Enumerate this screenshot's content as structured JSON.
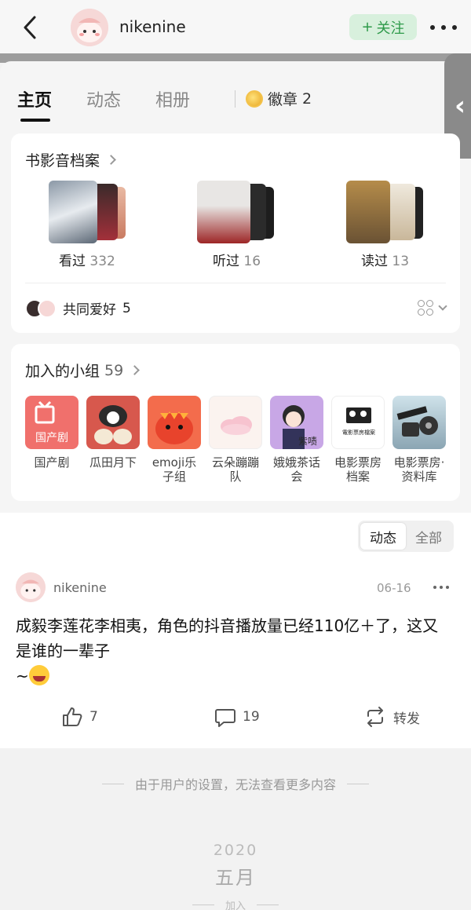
{
  "header": {
    "username": "nikenine",
    "follow_label": "关注",
    "follow_plus": "+"
  },
  "tabs": [
    {
      "label": "主页",
      "active": true
    },
    {
      "label": "动态",
      "active": false
    },
    {
      "label": "相册",
      "active": false
    }
  ],
  "badge": {
    "label": "徽章",
    "count": "2"
  },
  "archive": {
    "title": "书影音档案",
    "items": [
      {
        "label": "看过",
        "count": "332"
      },
      {
        "label": "听过",
        "count": "16"
      },
      {
        "label": "读过",
        "count": "13"
      }
    ],
    "common_label": "共同爱好",
    "common_count": "5"
  },
  "groups": {
    "title": "加入的小组",
    "count": "59",
    "items": [
      {
        "name": "国产剧",
        "img_text": "国产剧"
      },
      {
        "name": "瓜田月下"
      },
      {
        "name": "emoji乐子组"
      },
      {
        "name": "云朵蹦蹦队"
      },
      {
        "name": "娥娥茶话会",
        "img_text": "紫啧"
      },
      {
        "name": "电影票房档案",
        "img_text": "電影票房檔案"
      },
      {
        "name": "电影票房·资料库"
      }
    ]
  },
  "feed_filter": {
    "options": [
      "动态",
      "全部"
    ],
    "selected": "动态"
  },
  "post": {
    "username": "nikenine",
    "date": "06-16",
    "text": "成毅李莲花李相夷，角色的抖音播放量已经110亿＋了，这又是谁的一辈子",
    "text_tail": "~",
    "likes": "7",
    "comments": "19",
    "repost_label": "转发"
  },
  "footer": {
    "note": "由于用户的设置，无法查看更多内容",
    "year": "2020",
    "month": "五月",
    "join": "加入"
  },
  "colors": {
    "accent_green": "#2e9a4a",
    "follow_bg": "#d8f0dd"
  }
}
